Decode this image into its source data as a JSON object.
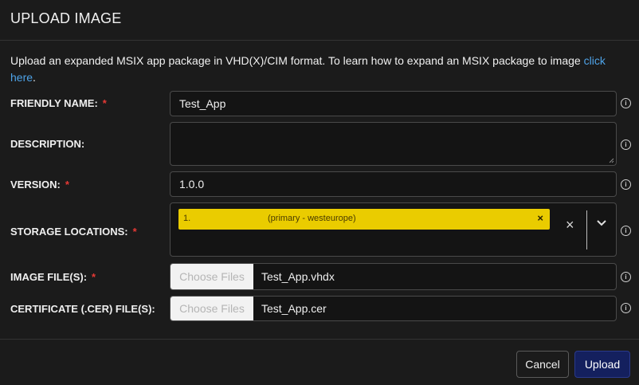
{
  "dialog": {
    "title": "UPLOAD IMAGE",
    "intro_text": "Upload an expanded MSIX app package in VHD(X)/CIM format. To learn how to expand an MSIX package to image ",
    "intro_link": "click here",
    "intro_end": "."
  },
  "form": {
    "friendly_name": {
      "label": "FRIENDLY NAME:",
      "required": "*",
      "value": "Test_App"
    },
    "description": {
      "label": "DESCRIPTION:",
      "value": ""
    },
    "version": {
      "label": "VERSION:",
      "required": "*",
      "value": "1.0.0"
    },
    "storage_locations": {
      "label": "STORAGE LOCATIONS:",
      "required": "*",
      "chip_index": "1.",
      "chip_text": "(primary - westeurope)",
      "chip_remove": "×",
      "clear": "×"
    },
    "image_files": {
      "label": "IMAGE FILE(S):",
      "required": "*",
      "button": "Choose Files",
      "value": "Test_App.vhdx"
    },
    "certificate_files": {
      "label": "CERTIFICATE (.CER) FILE(S):",
      "button": "Choose Files",
      "value": "Test_App.cer"
    }
  },
  "info_glyph": "i",
  "footer": {
    "cancel": "Cancel",
    "upload": "Upload"
  },
  "colors": {
    "accent_chip": "#eacc00",
    "required": "#e53935",
    "link": "#4ea3e8",
    "upload_btn": "#14205e"
  }
}
